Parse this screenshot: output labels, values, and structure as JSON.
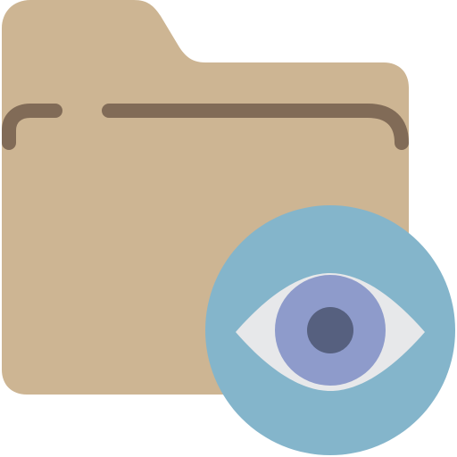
{
  "icon": {
    "name": "folder-view-icon",
    "parts": [
      "folder-icon",
      "eye-icon"
    ]
  },
  "colors": {
    "background": "#ffffff",
    "folder_fill": "#CDB593",
    "folder_edge": "#816B57",
    "badge_circle": "#84B5CB",
    "eye_white": "#E7E8EA",
    "iris": "#8E9BCB",
    "pupil": "#56607F"
  }
}
